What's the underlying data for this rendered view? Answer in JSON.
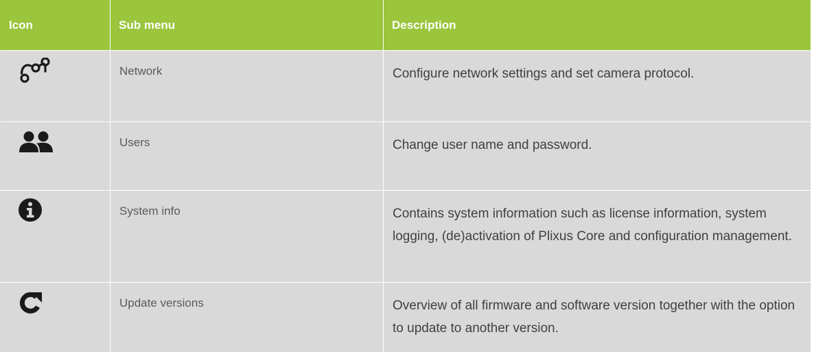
{
  "table": {
    "headers": {
      "icon": "Icon",
      "submenu": "Sub menu",
      "description": "Description"
    },
    "header_color": "#9ac53c",
    "row_color": "#d9d9d9",
    "rows": [
      {
        "icon": "network-icon",
        "submenu": "Network",
        "description": "Configure network settings and set camera protocol."
      },
      {
        "icon": "users-icon",
        "submenu": "Users",
        "description": "Change user name and password."
      },
      {
        "icon": "info-icon",
        "submenu": "System info",
        "description": "Contains system information such as license information, system logging, (de)activation of Plixus Core and configuration management."
      },
      {
        "icon": "refresh-icon",
        "submenu": "Update versions",
        "description": "Overview of all firmware and software version together with the option to update to another version."
      }
    ]
  }
}
